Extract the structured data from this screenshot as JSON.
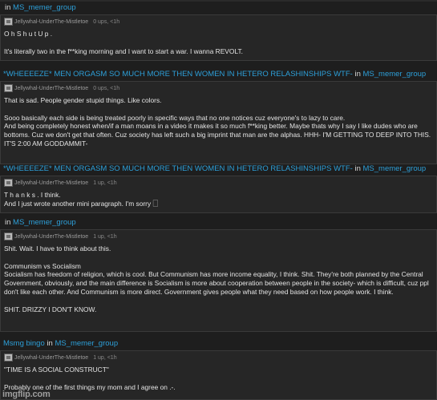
{
  "watermark": "imgflip.com",
  "items": [
    {
      "post_title": "",
      "in_text": "in",
      "stream": "MS_memer_group",
      "username": "Jellywhal-UnderThe-Mistletoe",
      "stats": "0 ups, <1h",
      "text": "O h S h u t U p .\n\nIt's literally two in the f**king morning and I want to start a war. I wanna REVOLT."
    },
    {
      "post_title": "*WHEEEEZE* MEN ORGASM SO MUCH MORE THEN WOMEN IN HETERO RELASHINSHIPS WTF-",
      "in_text": "in",
      "stream": "MS_memer_group",
      "username": "Jellywhal-UnderThe-Mistletoe",
      "stats": "0 ups, <1h",
      "text": "That is sad. People gender stupid things. Like colors.\n\nSooo basically each side is being treated poorly in specific ways that no one notices cuz everyone's to lazy to care.\nAnd being completely honest when/if a man moans in a video it makes it so much f**king better. Maybe thats why I say I like dudes who are bottoms. Cuz we don't get that often. Cuz society has left such a big imprint that man are the alphas. HHH- I'M GETTING TO DEEP INTO THIS. IT'S 2:00 AM GODDAMMIT-"
    },
    {
      "post_title": "*WHEEEEZE* MEN ORGASM SO MUCH MORE THEN WOMEN IN HETERO RELASHINSHIPS WTF-",
      "in_text": "in",
      "stream": "MS_memer_group",
      "username": "Jellywhal-UnderThe-Mistletoe",
      "stats": "1 up, <1h",
      "text": "T h a n k s . I think.\nAnd I just wrote another mini paragraph. I'm sorry 🗌"
    },
    {
      "post_title": "",
      "in_text": "in",
      "stream": "MS_memer_group",
      "username": "Jellywhal-UnderThe-Mistletoe",
      "stats": "1 up, <1h",
      "text": "Shit. Wait. I have to think about this.\n\nCommunism vs Socialism\nSocialism has freedom of religion, which is cool. But Communism has more income equality, I think. Shit. They're both planned by the Central Government, obviously, and the main difference is Socialism is more about cooperation between people in the society- which is difficult, cuz ppl don't like each other. And Communism is more direct. Government gives people what they need based on how people work. I think.\n\nSHIT. DRIZZY I DON'T KNOW."
    },
    {
      "post_title": "Msmg bingo",
      "in_text": "in",
      "stream": "MS_memer_group",
      "username": "Jellywhal-UnderThe-Mistletoe",
      "stats": "1 up, <1h",
      "text": "\"TIME IS A SOCIAL CONSTRUCT\"\n\nProbably one of the first things my mom and I agree on .-."
    }
  ]
}
